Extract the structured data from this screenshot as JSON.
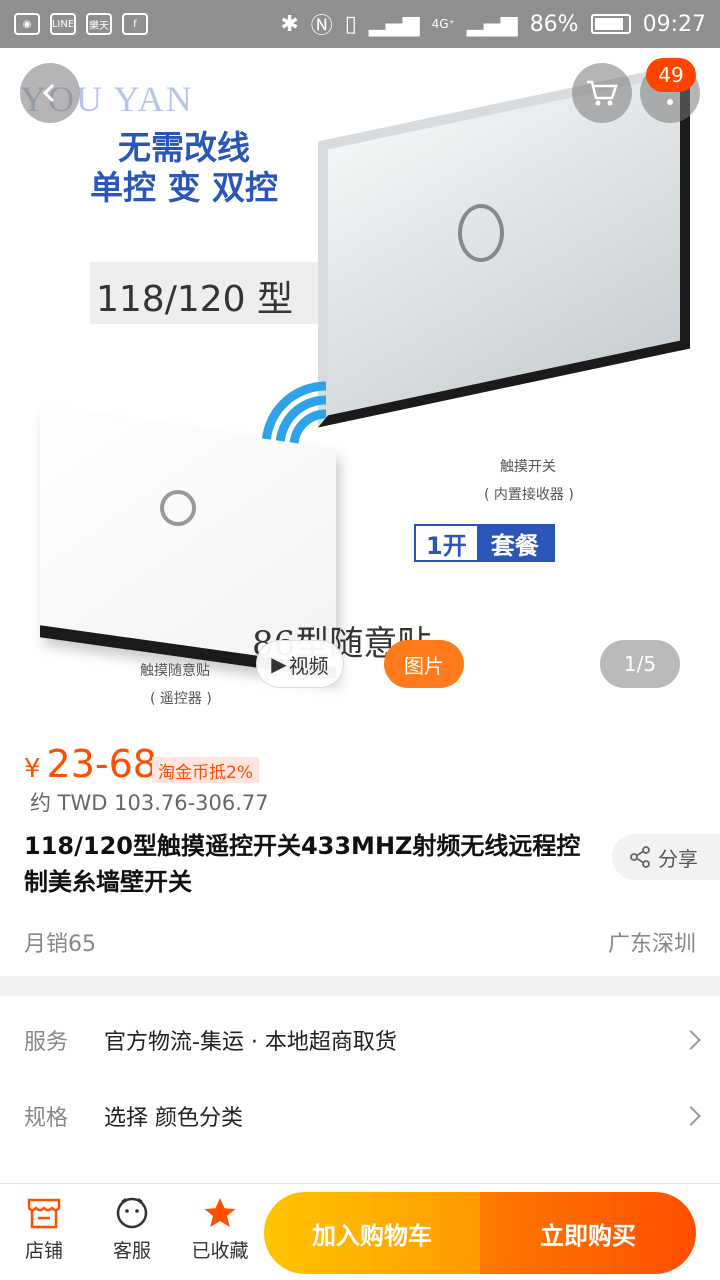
{
  "status_bar": {
    "left_icons": [
      "mi-icon",
      "line-icon",
      "rakuten-icon",
      "facebook-icon"
    ],
    "line_text": "LINE",
    "rakuten_text": "樂天",
    "network": "4G⁺",
    "battery": "86%",
    "time": "09:27"
  },
  "hero": {
    "watermark": "YOU YAN",
    "promo_line1": "无需改线",
    "promo_line2": "单控 变 双控",
    "model": "118/120 型",
    "touch_switch": "触摸开关",
    "touch_switch_sub": "( 内置接收器 )",
    "package_a": "1开",
    "package_b": "套餐",
    "model_86": "86型随意贴",
    "remote_label": "触摸随意贴",
    "remote_sub": "( 遥控器 )",
    "cart_badge": "49",
    "video_label": "视频",
    "photo_label": "图片",
    "pager": "1/5"
  },
  "product": {
    "currency": "¥",
    "price": "23-68",
    "coin_tag": "淘金币抵2%",
    "twd": "约 TWD 103.76-306.77",
    "title": "118/120型触摸遥控开关433MHZ射频无线远程控制美糸墙壁开关",
    "share": "分享",
    "sales": "月销65",
    "location": "广东深圳"
  },
  "rows": {
    "service_label": "服务",
    "service_value": "官方物流-集运 · 本地超商取货",
    "spec_label": "规格",
    "spec_value": "选择 颜色分类"
  },
  "bottom_bar": {
    "store": "店铺",
    "service": "客服",
    "favorite": "已收藏",
    "add_cart": "加入购物车",
    "buy_now": "立即购买"
  },
  "colors": {
    "accent": "#ff4e00",
    "cart_gradient_start": "#ffc400",
    "buy_gradient_end": "#ff4e00",
    "blue": "#2a56b8"
  }
}
